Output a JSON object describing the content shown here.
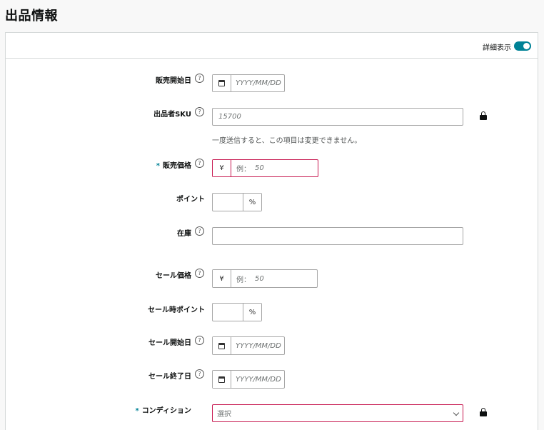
{
  "page": {
    "title": "出品情報"
  },
  "header": {
    "toggle_label": "詳細表示",
    "toggle_on": true
  },
  "help_glyph": "?",
  "fields": {
    "sale_start_date": {
      "label": "販売開始日",
      "placeholder": "YYYY/MM/DD",
      "icon": "calendar-icon"
    },
    "seller_sku": {
      "label": "出品者SKU",
      "value": "15700",
      "hint": "一度送信すると、この項目は変更できません。",
      "locked": true
    },
    "price": {
      "required_mark": "*",
      "label": "販売価格",
      "currency": "¥",
      "example_prefix": "例：",
      "placeholder": "50"
    },
    "points": {
      "label": "ポイント",
      "unit": "%"
    },
    "stock": {
      "label": "在庫"
    },
    "sale_price": {
      "label": "セール価格",
      "currency": "¥",
      "example_prefix": "例：",
      "placeholder": "50"
    },
    "sale_points": {
      "label": "セール時ポイント",
      "unit": "%"
    },
    "sale_start": {
      "label": "セール開始日",
      "placeholder": "YYYY/MM/DD"
    },
    "sale_end": {
      "label": "セール終了日",
      "placeholder": "YYYY/MM/DD"
    },
    "condition": {
      "required_mark": "*",
      "label": "コンディション",
      "selected": "選択",
      "locked": true
    }
  },
  "colors": {
    "accent": "#008296",
    "error": "#c7174f",
    "border": "#a6a6a6"
  }
}
